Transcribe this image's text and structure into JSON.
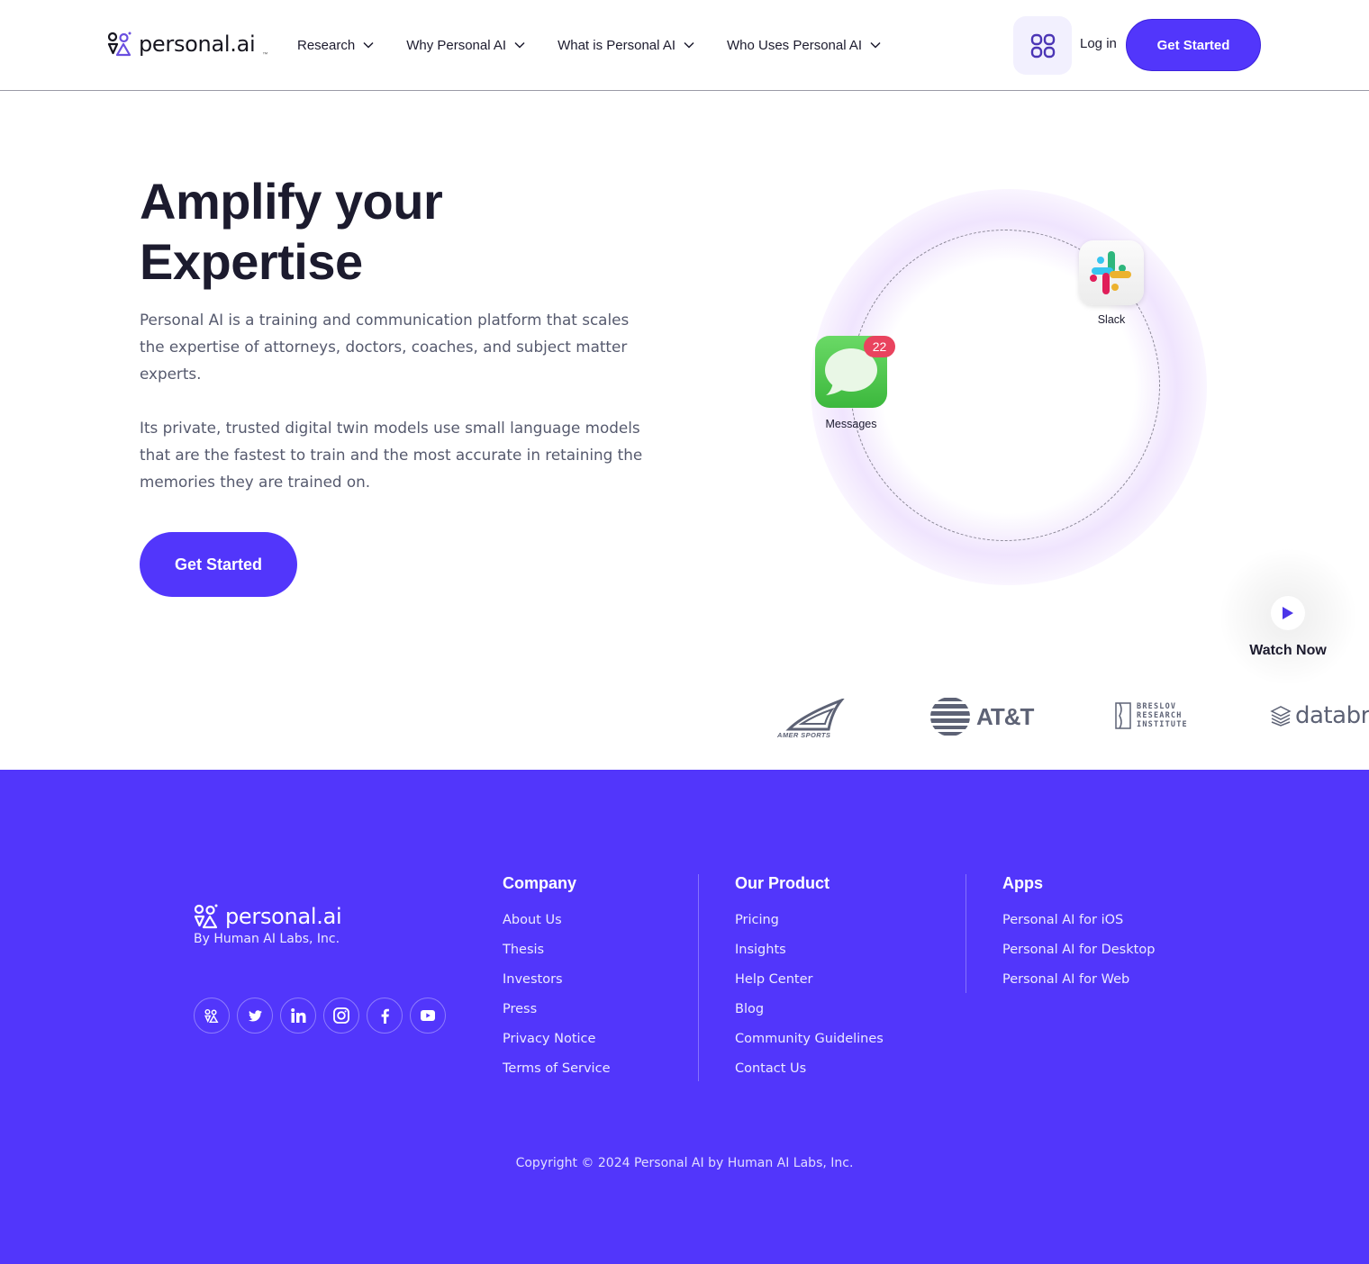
{
  "header": {
    "logo_text": "personal.ai",
    "logo_tm": "™",
    "nav": [
      {
        "label": "Research"
      },
      {
        "label": "Why Personal AI"
      },
      {
        "label": "What is Personal AI"
      },
      {
        "label": "Who Uses Personal AI"
      }
    ],
    "apps_icon": "grid-icon",
    "login_label": "Log in",
    "cta_label": "Get Started"
  },
  "hero": {
    "title_line1": "Amplify your",
    "title_line2": "Expertise",
    "paragraph1": "Personal AI is a training and communication platform that scales the expertise of attorneys, doctors, coaches, and subject matter experts.",
    "paragraph2": "Its private, trusted digital twin models use small language models that are the fastest to train and the most accurate in retaining the memories they are trained on.",
    "cta_label": "Get Started"
  },
  "orbit": {
    "apps": [
      {
        "name": "Slack",
        "icon": "slack-icon"
      },
      {
        "name": "Messages",
        "icon": "messages-icon",
        "badge": "22"
      }
    ]
  },
  "watch": {
    "label": "Watch Now",
    "icon": "play-icon"
  },
  "logos": [
    {
      "name": "AMER SPORTS"
    },
    {
      "name": "AT&T"
    },
    {
      "name": "BRESLOV RESEARCH INSTITUTE",
      "lines": [
        "BRESLOV",
        "RESEARCH",
        "INSTITUTE"
      ]
    },
    {
      "name": "databricks",
      "visible_text": "databri"
    }
  ],
  "colors": {
    "brand": "#5236fb",
    "text_dark": "#1c1b2e",
    "text_muted": "#565a6e",
    "badge_red": "#e9435e"
  },
  "footer": {
    "logo_text": "personal.ai",
    "tagline": "By Human AI Labs, Inc.",
    "socials": [
      {
        "icon": "personal-ai-icon"
      },
      {
        "icon": "twitter-icon"
      },
      {
        "icon": "linkedin-icon"
      },
      {
        "icon": "instagram-icon"
      },
      {
        "icon": "facebook-icon"
      },
      {
        "icon": "youtube-icon"
      }
    ],
    "columns": [
      {
        "title": "Company",
        "links": [
          "About Us",
          "Thesis",
          "Investors",
          "Press",
          "Privacy Notice",
          "Terms of Service"
        ]
      },
      {
        "title": "Our Product",
        "links": [
          "Pricing",
          "Insights",
          "Help Center",
          "Blog",
          "Community Guidelines",
          "Contact Us"
        ]
      },
      {
        "title": "Apps",
        "links": [
          "Personal AI for iOS",
          "Personal AI for Desktop",
          "Personal AI for Web"
        ]
      }
    ],
    "copyright": "Copyright © 2024 Personal AI by Human AI Labs, Inc."
  }
}
